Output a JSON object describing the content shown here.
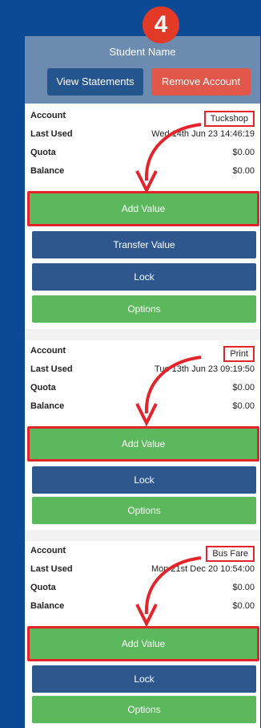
{
  "step_number": "4",
  "header": {
    "student_name": "Student Name",
    "view_statements": "View Statements",
    "remove_account": "Remove Account"
  },
  "labels": {
    "account": "Account",
    "last_used": "Last Used",
    "quota": "Quota",
    "balance": "Balance"
  },
  "accounts": [
    {
      "account": "Tuckshop",
      "last_used": "Wed 14th Jun 23 14:46:19",
      "quota": "$0.00",
      "balance": "$0.00",
      "buttons": [
        "Add Value",
        "Transfer Value",
        "Lock",
        "Options"
      ]
    },
    {
      "account": "Print",
      "last_used": "Tue 13th Jun 23 09:19:50",
      "quota": "$0.00",
      "balance": "$0.00",
      "buttons": [
        "Add Value",
        "Lock",
        "Options"
      ]
    },
    {
      "account": "Bus Fare",
      "last_used": "Mon 21st Dec 20 10:54:00",
      "quota": "$0.00",
      "balance": "$0.00",
      "buttons": [
        "Add Value",
        "Lock",
        "Options"
      ]
    }
  ],
  "colors": {
    "background": "#0d4a96",
    "header": "#6b8bb0",
    "green_button": "#5cb85c",
    "blue_button": "#2d578d",
    "remove_button": "#e1584b",
    "annotation_red": "#e3242b"
  }
}
